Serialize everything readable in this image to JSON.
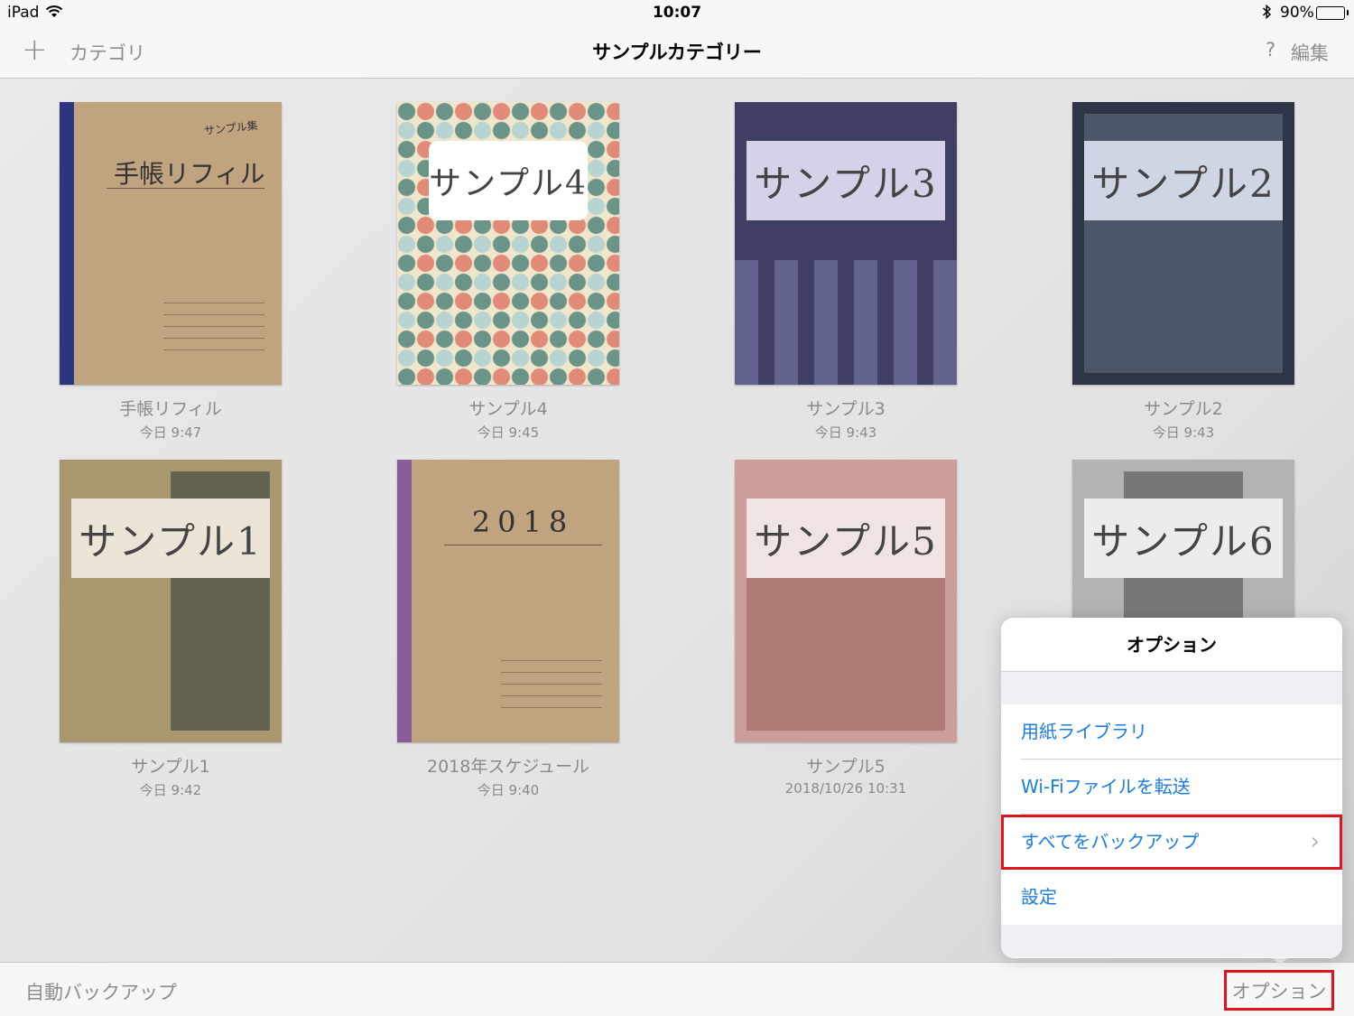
{
  "status_bar": {
    "device": "iPad",
    "time": "10:07",
    "battery": "90%",
    "battery_level": 0.9
  },
  "nav": {
    "add_icon": "+",
    "category_label": "カテゴリ",
    "title": "サンプルカテゴリー",
    "help_label": "?",
    "edit_label": "編集"
  },
  "books": [
    {
      "name": "手帳リフィル",
      "date": "今日 9:47",
      "cover_title": "手帳リフィル",
      "cover_sub": "サンプル集"
    },
    {
      "name": "サンプル4",
      "date": "今日 9:45",
      "cover_title": "サンプル4"
    },
    {
      "name": "サンプル3",
      "date": "今日 9:43",
      "cover_title": "サンプル3"
    },
    {
      "name": "サンプル2",
      "date": "今日 9:43",
      "cover_title": "サンプル2"
    },
    {
      "name": "サンプル1",
      "date": "今日 9:42",
      "cover_title": "サンプル1"
    },
    {
      "name": "2018年スケジュール",
      "date": "今日 9:40",
      "cover_title": "2018"
    },
    {
      "name": "サンプル5",
      "date": "2018/10/26 10:31",
      "cover_title": "サンプル5"
    },
    {
      "name": "",
      "date": "",
      "cover_title": "サンプル6"
    }
  ],
  "bottom_bar": {
    "auto_backup_label": "自動バックアップ",
    "options_label": "オプション"
  },
  "popover": {
    "title": "オプション",
    "items": [
      {
        "label": "用紙ライブラリ"
      },
      {
        "label": "Wi-Fiファイルを転送"
      },
      {
        "label": "すべてをバックアップ",
        "chevron": "›"
      },
      {
        "label": "設定"
      }
    ]
  },
  "colors": {
    "accent": "#1a7de0",
    "highlight": "#e0141e",
    "kraft": "#c0a37f"
  }
}
